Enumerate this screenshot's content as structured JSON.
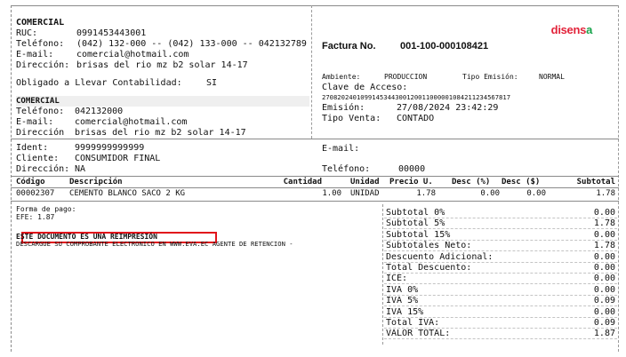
{
  "seller": {
    "name": "COMERCIAL",
    "ruc_label": "RUC:",
    "ruc": "0991453443001",
    "phone_label": "Teléfono:",
    "phone": "(042) 132-000 -- (042) 133-000 -- 042132789",
    "email_label": "E-mail:",
    "email": "comercial@hotmail.com",
    "address_label": "Dirección:",
    "address": "brisas del rio mz b2 solar 14-17",
    "accounting_label": "Obligado a Llevar Contabilidad:",
    "accounting": "SI"
  },
  "branch": {
    "name": "COMERCIAL",
    "phone_label": "Teléfono:",
    "phone": "042132000",
    "email_label": "E-mail:",
    "email": "comercial@hotmail.com",
    "address_label": "Dirección",
    "address": "brisas del rio mz b2 solar 14-17"
  },
  "invoice": {
    "title": "Factura No.",
    "number": "001-100-000108421",
    "logo_text": "disens",
    "logo_dot": "a",
    "env_label": "Ambiente:",
    "env": "PRODUCCION",
    "emission_type_label": "Tipo Emisión:",
    "emission_type": "NORMAL",
    "access_key_label": "Clave de Acceso:",
    "access_key": "2708202401099145344300120011000001084211234567817",
    "date_label": "Emisión:",
    "date": "27/08/2024 23:42:29",
    "sale_type_label": "Tipo Venta:",
    "sale_type": "CONTADO"
  },
  "client": {
    "ident_label": "Ident:",
    "ident": "9999999999999",
    "name_label": "Cliente:",
    "name": "CONSUMIDOR FINAL",
    "address_label": "Dirección:",
    "address": "NA",
    "email_label": "E-mail:",
    "email": "",
    "phone_label": "Teléfono:",
    "phone": "00000"
  },
  "table": {
    "headers": {
      "code": "Código",
      "description": "Descripción",
      "qty": "Cantidad",
      "unit": "Unidad",
      "price": "Precio U.",
      "disc_pct": "Desc (%)",
      "disc_amt": "Desc ($)",
      "subtotal": "Subtotal"
    },
    "rows": [
      {
        "code": "00002307",
        "description": "CEMENTO BLANCO SACO 2 KG",
        "qty": "1.00",
        "unit": "UNIDAD",
        "price": "1.78",
        "disc_pct": "0.00",
        "disc_amt": "0.00",
        "subtotal": "1.78"
      }
    ]
  },
  "payment": {
    "label": "Forma de pago:",
    "method": "EFE: 1.87",
    "reprint_notice": "ESTE DOCUMENTO ES UNA REIMPRESIÓN",
    "download_note": "DESCARGUE SU COMPROBANTE ELECTRONICO EN WWW.EVA.EC  AGENTE DE RETENCION -"
  },
  "totals": [
    {
      "label": "Subtotal 0%",
      "value": "0.00"
    },
    {
      "label": "Subtotal 5%",
      "value": "1.78"
    },
    {
      "label": "Subtotal 15%",
      "value": "0.00"
    },
    {
      "label": "Subtotales Neto:",
      "value": "1.78"
    },
    {
      "label": "Descuento Adicional:",
      "value": "0.00"
    },
    {
      "label": "Total Descuento:",
      "value": "0.00"
    },
    {
      "label": "ICE:",
      "value": "0.00"
    },
    {
      "label": "IVA 0%",
      "value": "0.00"
    },
    {
      "label": "IVA 5%",
      "value": "0.09"
    },
    {
      "label": "IVA 15%",
      "value": "0.00"
    },
    {
      "label": "Total IVA:",
      "value": "0.09"
    },
    {
      "label": "VALOR TOTAL:",
      "value": "1.87"
    }
  ],
  "colors": {
    "logo": "#e2233a",
    "logo_dot": "#16a34a",
    "reprint_box": "#e1141b"
  }
}
